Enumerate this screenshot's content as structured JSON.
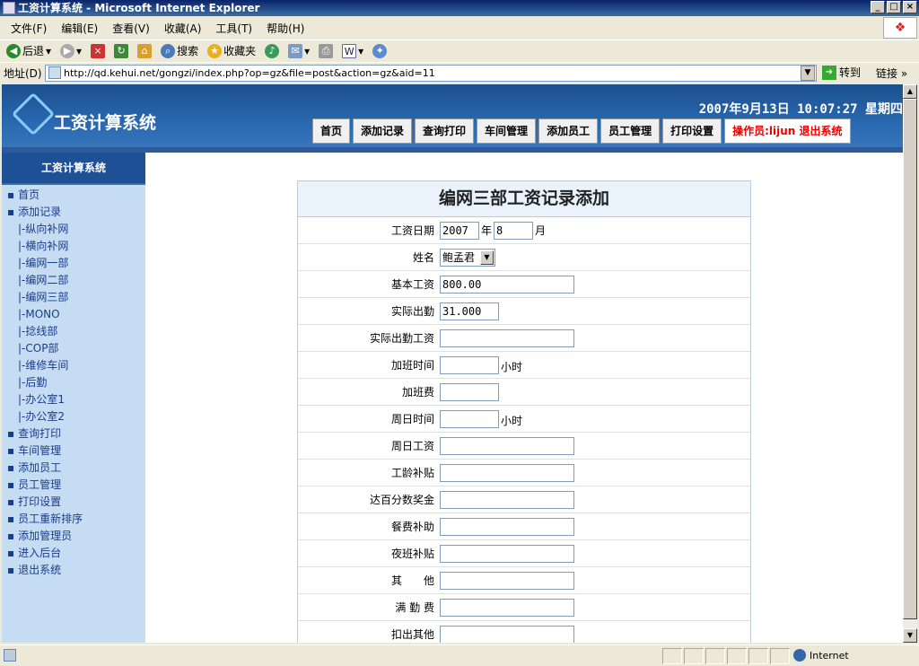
{
  "window": {
    "title": "工资计算系统 - Microsoft Internet Explorer"
  },
  "menu": [
    "文件(F)",
    "编辑(E)",
    "查看(V)",
    "收藏(A)",
    "工具(T)",
    "帮助(H)"
  ],
  "toolbar": {
    "back": "后退",
    "search": "搜索",
    "favorites": "收藏夹"
  },
  "address": {
    "label": "地址(D)",
    "url": "http://qd.kehui.net/gongzi/index.php?op=gz&file=post&action=gz&aid=11",
    "go": "转到",
    "links": "链接"
  },
  "header": {
    "title": "工资计算系统",
    "datetime": "2007年9月13日 10:07:27 星期四"
  },
  "nav": [
    "首页",
    "添加记录",
    "查询打印",
    "车间管理",
    "添加员工",
    "员工管理",
    "打印设置"
  ],
  "operator": "操作员:lijun 退出系统",
  "sidebar": {
    "title": "工资计算系统",
    "items": [
      {
        "label": "首页",
        "sub": false
      },
      {
        "label": "添加记录",
        "sub": false
      },
      {
        "label": "|-纵向补网",
        "sub": true
      },
      {
        "label": "|-横向补网",
        "sub": true
      },
      {
        "label": "|-编网一部",
        "sub": true
      },
      {
        "label": "|-编网二部",
        "sub": true
      },
      {
        "label": "|-编网三部",
        "sub": true
      },
      {
        "label": "|-MONO",
        "sub": true
      },
      {
        "label": "|-捻线部",
        "sub": true
      },
      {
        "label": "|-COP部",
        "sub": true
      },
      {
        "label": "|-维修车间",
        "sub": true
      },
      {
        "label": "|-后勤",
        "sub": true
      },
      {
        "label": "|-办公室1",
        "sub": true
      },
      {
        "label": "|-办公室2",
        "sub": true
      },
      {
        "label": "查询打印",
        "sub": false
      },
      {
        "label": "车间管理",
        "sub": false
      },
      {
        "label": "添加员工",
        "sub": false
      },
      {
        "label": "员工管理",
        "sub": false
      },
      {
        "label": "打印设置",
        "sub": false
      },
      {
        "label": "员工重新排序",
        "sub": false
      },
      {
        "label": "添加管理员",
        "sub": false
      },
      {
        "label": "进入后台",
        "sub": false
      },
      {
        "label": "退出系统",
        "sub": false
      }
    ]
  },
  "form": {
    "title": "编网三部工资记录添加",
    "date_label": "工资日期",
    "year": "2007",
    "year_unit": "年",
    "month": "8",
    "month_unit": "月",
    "name_label": "姓名",
    "name_value": "鲍孟君",
    "fields": [
      {
        "label": "基本工资",
        "value": "800.00",
        "width": "w150",
        "unit": ""
      },
      {
        "label": "实际出勤",
        "value": "31.000",
        "width": "w66",
        "unit": ""
      },
      {
        "label": "实际出勤工资",
        "value": "",
        "width": "w150",
        "unit": ""
      },
      {
        "label": "加班时间",
        "value": "",
        "width": "w66",
        "unit": "小时"
      },
      {
        "label": "加班费",
        "value": "",
        "width": "w66",
        "unit": ""
      },
      {
        "label": "周日时间",
        "value": "",
        "width": "w66",
        "unit": "小时"
      },
      {
        "label": "周日工资",
        "value": "",
        "width": "w150",
        "unit": ""
      },
      {
        "label": "工龄补贴",
        "value": "",
        "width": "w150",
        "unit": ""
      },
      {
        "label": "达百分数奖金",
        "value": "",
        "width": "w150",
        "unit": ""
      },
      {
        "label": "餐费补助",
        "value": "",
        "width": "w150",
        "unit": ""
      },
      {
        "label": "夜班补贴",
        "value": "",
        "width": "w150",
        "unit": ""
      },
      {
        "label": "其　　他",
        "value": "",
        "width": "w150",
        "unit": ""
      },
      {
        "label": "满 勤 费",
        "value": "",
        "width": "w150",
        "unit": ""
      },
      {
        "label": "扣出其他",
        "value": "",
        "width": "w150",
        "unit": ""
      }
    ]
  },
  "status": {
    "zone": "Internet"
  }
}
